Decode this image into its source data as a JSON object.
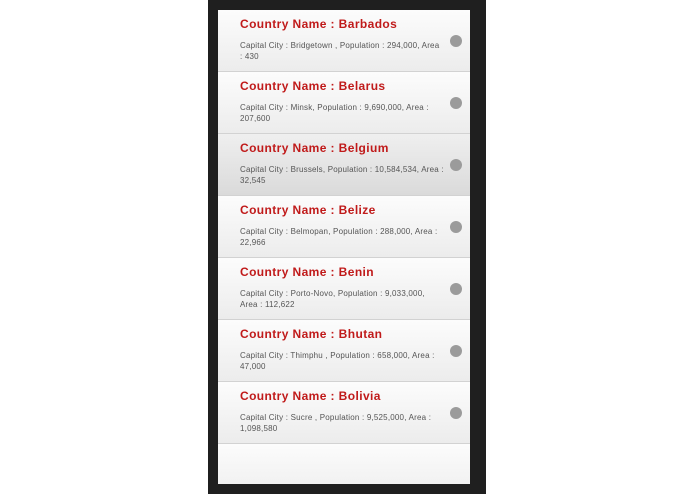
{
  "countries": [
    {
      "name_label": "Country Name : Barbados",
      "details": "Capital City : Bridgetown , Population : 294,000, Area : 430"
    },
    {
      "name_label": "Country Name : Belarus",
      "details": "Capital City : Minsk, Population : 9,690,000, Area : 207,600"
    },
    {
      "name_label": "Country Name : Belgium",
      "details": "Capital City : Brussels, Population : 10,584,534, Area : 32,545"
    },
    {
      "name_label": "Country Name : Belize",
      "details": "Capital City : Belmopan, Population : 288,000, Area : 22,966"
    },
    {
      "name_label": "Country Name : Benin",
      "details": "Capital City : Porto-Novo, Population : 9,033,000, Area : 112,622"
    },
    {
      "name_label": "Country Name : Bhutan",
      "details": "Capital City : Thimphu , Population : 658,000, Area : 47,000"
    },
    {
      "name_label": "Country Name : Bolivia",
      "details": "Capital City : Sucre , Population : 9,525,000, Area : 1,098,580"
    }
  ],
  "icons": {
    "row_indicator": "chevron-circle-icon",
    "indicator_color": "#9b9b9b"
  },
  "colors": {
    "country_name": "#c01a1a",
    "detail_text": "#555555",
    "device_frame": "#1f1f1f"
  }
}
